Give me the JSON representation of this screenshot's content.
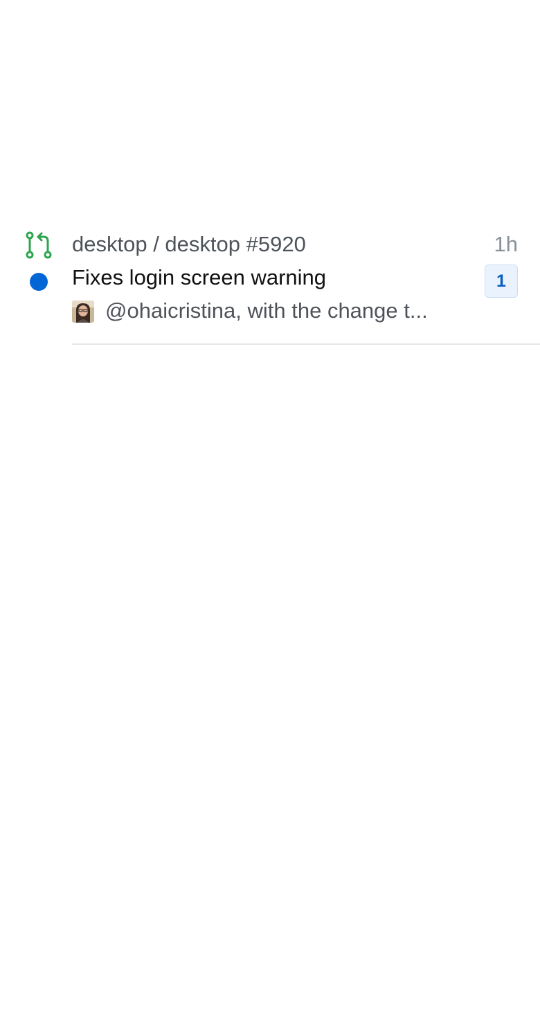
{
  "notification": {
    "icon": "pull-request-icon",
    "unread": true,
    "repo_line": "desktop / desktop #5920",
    "time": "1h",
    "title": "Fixes login screen warning",
    "count_badge": "1",
    "comment_preview": "@ohaicristina, with the change t...",
    "avatar": "avatar-image"
  },
  "colors": {
    "pr_icon": "#2ea44f",
    "unread_dot": "#0366d6",
    "badge_bg": "#eaf3fd",
    "badge_text": "#0a5cc2",
    "muted_text": "#4e535a",
    "divider": "#e3e5e8"
  }
}
